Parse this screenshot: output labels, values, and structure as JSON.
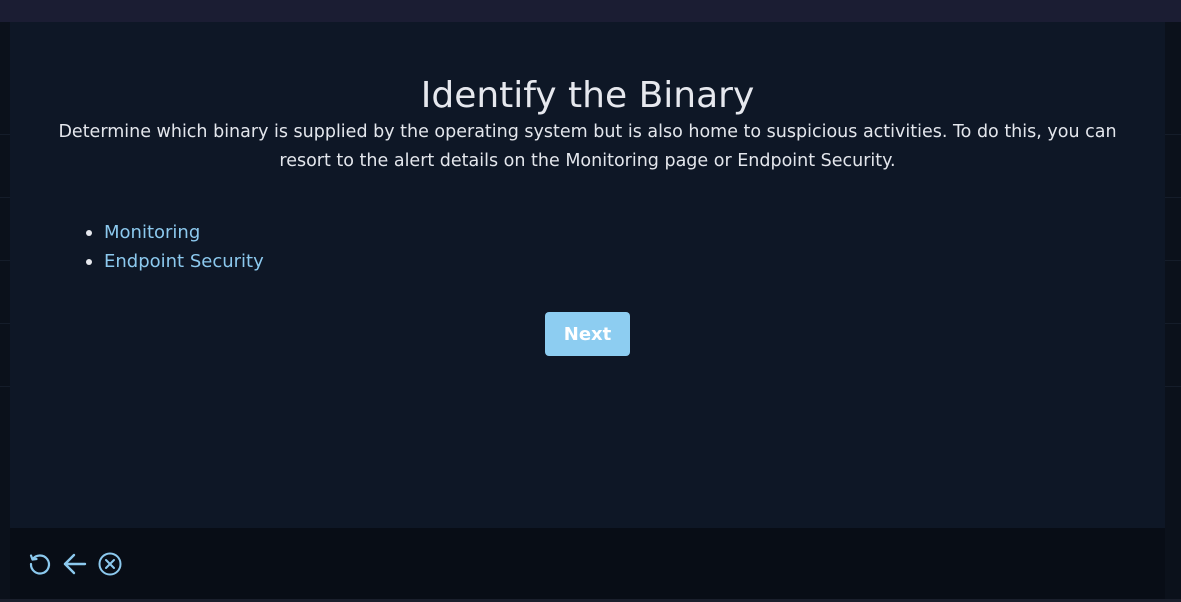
{
  "modal": {
    "title": "Identify the Binary",
    "description": "Determine which binary is supplied by the operating system but is also home to suspicious activities. To do this, you can resort to the alert details on the Monitoring page or Endpoint Security.",
    "links": [
      "Monitoring",
      "Endpoint Security"
    ],
    "next_label": "Next"
  },
  "footer": {
    "icons": [
      "restart-icon",
      "back-arrow-icon",
      "close-circle-icon"
    ]
  },
  "colors": {
    "accent": "#8dcdf1",
    "link": "#8cc9ee",
    "modal_bg": "#0e1726",
    "footer_bg": "#080d16"
  }
}
